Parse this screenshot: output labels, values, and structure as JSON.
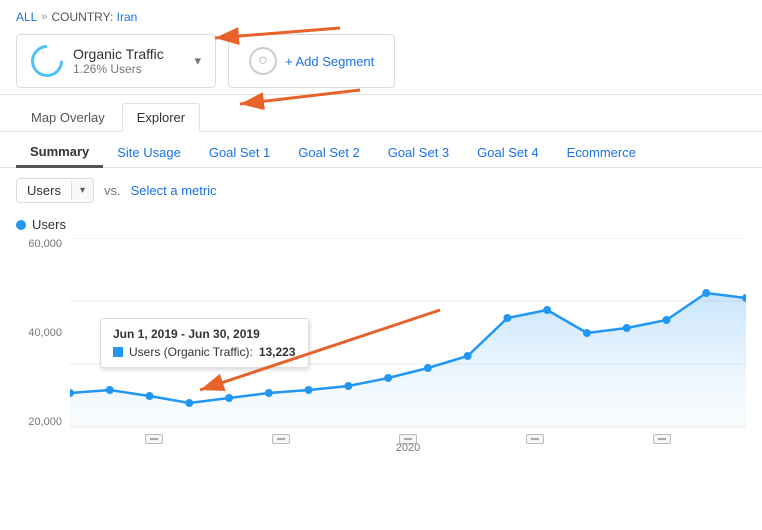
{
  "breadcrumb": {
    "all_label": "ALL",
    "separator": "»",
    "country_prefix": "COUNTRY:",
    "country_name": "Iran"
  },
  "segment": {
    "name": "Organic Traffic",
    "percentage": "1.26% Users",
    "dropdown_char": "▾"
  },
  "add_segment": {
    "label": "+ Add Segment"
  },
  "view_tabs": [
    {
      "label": "Map Overlay",
      "active": false
    },
    {
      "label": "Explorer",
      "active": true
    }
  ],
  "metric_tabs": [
    {
      "label": "Summary",
      "active": true
    },
    {
      "label": "Site Usage",
      "active": false
    },
    {
      "label": "Goal Set 1",
      "active": false
    },
    {
      "label": "Goal Set 2",
      "active": false
    },
    {
      "label": "Goal Set 3",
      "active": false
    },
    {
      "label": "Goal Set 4",
      "active": false
    },
    {
      "label": "Ecommerce",
      "active": false
    }
  ],
  "controls": {
    "metric_label": "Users",
    "vs_label": "vs.",
    "select_metric_label": "Select a metric"
  },
  "chart": {
    "legend_label": "Users",
    "y_labels": [
      "60,000",
      "40,000",
      "20,000"
    ],
    "x_label": "2020",
    "tooltip": {
      "date": "Jun 1, 2019 - Jun 30, 2019",
      "metric": "Users (Organic Traffic):",
      "value": "13,223"
    }
  }
}
